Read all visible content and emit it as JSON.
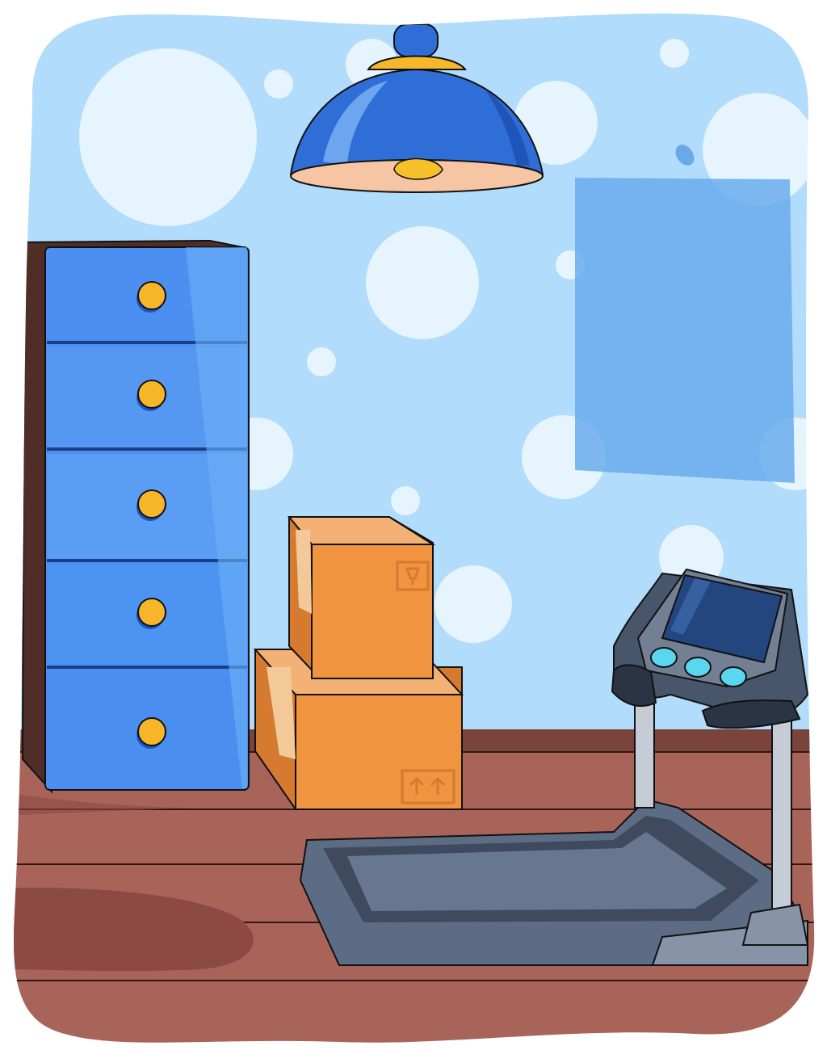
{
  "scene": {
    "kind": "room-interior",
    "objects": [
      "ceiling-lamp",
      "chest-of-drawers",
      "cardboard-boxes",
      "treadmill",
      "wall-poster"
    ],
    "drawer_count": 5,
    "box_count": 2,
    "treadmill_button_count": 3
  },
  "palette": {
    "wall": "#b1dcfb",
    "bubble": "#e6f4fd",
    "floor": "#a9645a",
    "floor_dark": "#8c4a42",
    "baseboard": "#7a433c",
    "cabinet": "#4b8ff0",
    "cabinet_side": "#4e2e27",
    "knob": "#f7b52a",
    "box": "#f0943f",
    "box_dark": "#d57a2f",
    "tape": "#f3c99a",
    "lamp_shade": "#2f6ed6",
    "lamp_band": "#f5b82a",
    "lamp_glow": "#f6c5a3",
    "poster": "#6aacec",
    "treadmill": "#5c6c84",
    "treadmill_dark": "#2b3444",
    "screen": "#24467f",
    "button": "#59d7f0"
  }
}
